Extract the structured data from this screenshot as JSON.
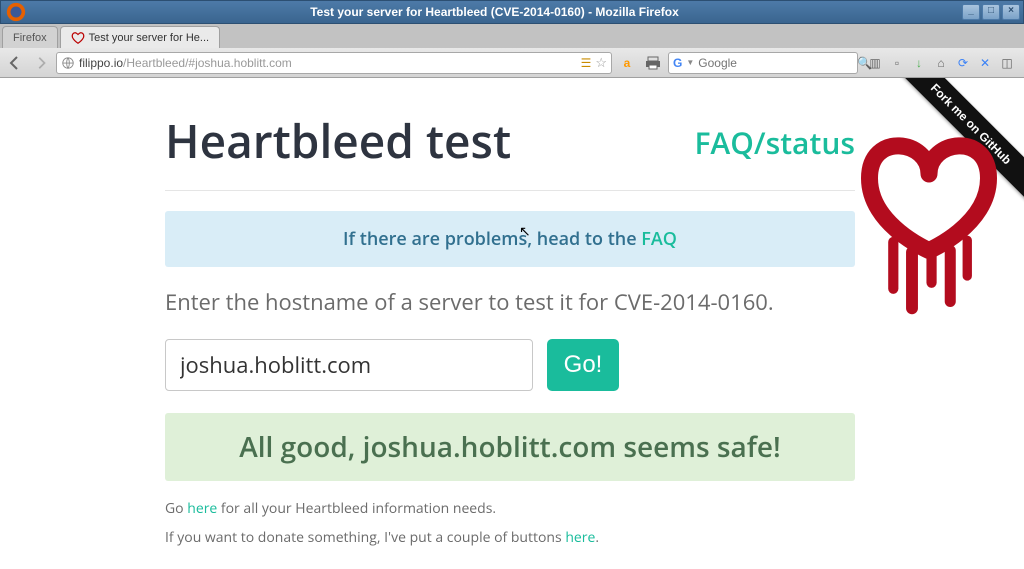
{
  "window": {
    "title": "Test your server for Heartbleed (CVE-2014-0160) - Mozilla Firefox"
  },
  "tabs": [
    {
      "label": "Firefox"
    },
    {
      "label": "Test your server for He..."
    }
  ],
  "nav": {
    "url_prefix": "filippo.io",
    "url_rest": "/Heartbleed/#joshua.hoblitt.com",
    "search_engine": "Google"
  },
  "page": {
    "ribbon": "Fork me on GitHub",
    "title": "Heartbleed test",
    "faq_link": "FAQ/status",
    "alert_prefix": "If there are problems, head to the ",
    "alert_link": "FAQ",
    "lead": "Enter the hostname of a server to test it for CVE-2014-0160.",
    "hostname_value": "joshua.hoblitt.com",
    "go_label": "Go!",
    "result": "All good, joshua.hoblitt.com seems safe!",
    "foot1_pre": "Go ",
    "foot1_link": "here",
    "foot1_post": " for all your Heartbleed information needs.",
    "foot2_pre": "If you want to donate something, I've put a couple of buttons ",
    "foot2_link": "here",
    "foot2_post": "."
  }
}
